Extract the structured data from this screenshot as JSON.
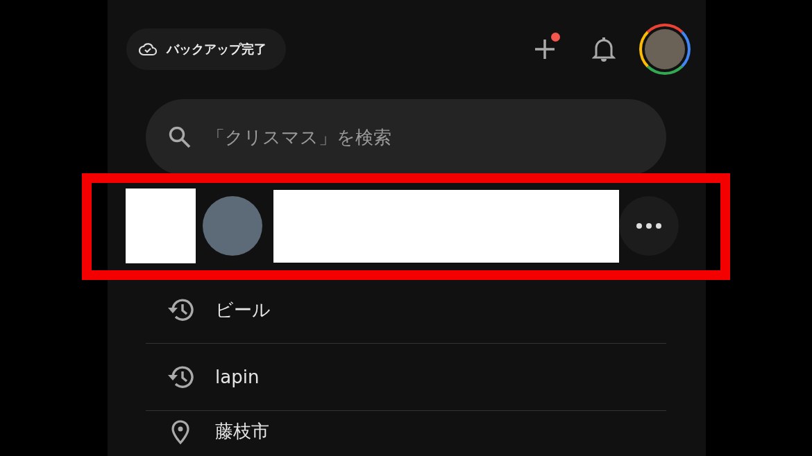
{
  "top_bar": {
    "backup_status": "バックアップ完了",
    "create_has_badge": true
  },
  "search": {
    "placeholder": "「クリスマス」を検索"
  },
  "person_row": {
    "highlighted": true
  },
  "suggestions": [
    {
      "kind": "history",
      "label": "ビール"
    },
    {
      "kind": "history",
      "label": "lapin"
    },
    {
      "kind": "place",
      "label": "藤枝市"
    }
  ]
}
